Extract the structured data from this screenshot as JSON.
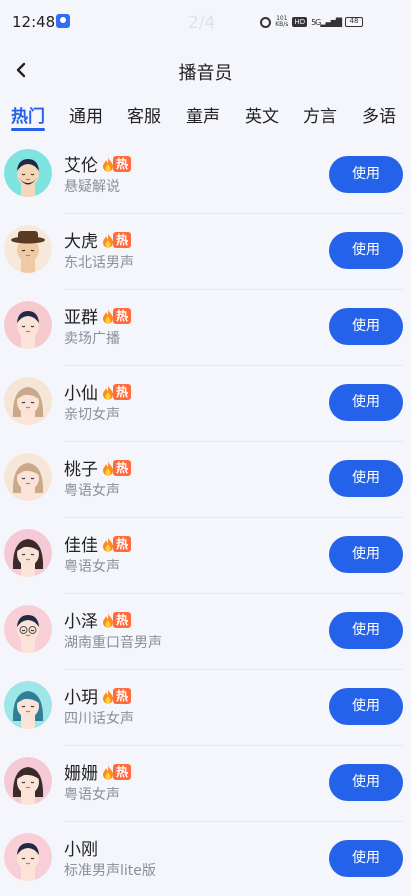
{
  "status_bar": {
    "time": "12:48",
    "page_indicator": "2/4",
    "speed_top": "101",
    "speed_unit": "KB/s",
    "hd": "HD",
    "network": "5G",
    "battery": "48"
  },
  "header": {
    "title": "播音员"
  },
  "tabs": [
    {
      "label": "热门"
    },
    {
      "label": "通用"
    },
    {
      "label": "客服"
    },
    {
      "label": "童声"
    },
    {
      "label": "英文"
    },
    {
      "label": "方言"
    },
    {
      "label": "多语"
    }
  ],
  "voices": [
    {
      "name": "艾伦",
      "desc": "悬疑解说",
      "hot": "热",
      "button": "使用",
      "avatar": "man-beard-avatar"
    },
    {
      "name": "大虎",
      "desc": "东北话男声",
      "hot": "热",
      "button": "使用",
      "avatar": "man-hat-avatar"
    },
    {
      "name": "亚群",
      "desc": "卖场广播",
      "hot": "热",
      "button": "使用",
      "avatar": "woman-short-hair-avatar"
    },
    {
      "name": "小仙",
      "desc": "亲切女声",
      "hot": "热",
      "button": "使用",
      "avatar": "girl-long-hair-avatar"
    },
    {
      "name": "桃子",
      "desc": "粤语女声",
      "hot": "热",
      "button": "使用",
      "avatar": "girl-long-hair-avatar"
    },
    {
      "name": "佳佳",
      "desc": "粤语女声",
      "hot": "热",
      "button": "使用",
      "avatar": "girl-dark-hair-avatar"
    },
    {
      "name": "小泽",
      "desc": "湖南重口音男声",
      "hot": "热",
      "button": "使用",
      "avatar": "man-glasses-avatar"
    },
    {
      "name": "小玥",
      "desc": "四川话女声",
      "hot": "热",
      "button": "使用",
      "avatar": "girl-teal-avatar"
    },
    {
      "name": "姗姗",
      "desc": "粤语女声",
      "hot": "热",
      "button": "使用",
      "avatar": "girl-dark-hair-avatar"
    },
    {
      "name": "小刚",
      "desc": "标准男声lite版",
      "hot": "",
      "button": "使用",
      "avatar": "man-short-hair-avatar"
    }
  ],
  "colors": {
    "accent": "#2462ea",
    "hot": "#ff6b3d",
    "background": "#f4f6fb"
  }
}
